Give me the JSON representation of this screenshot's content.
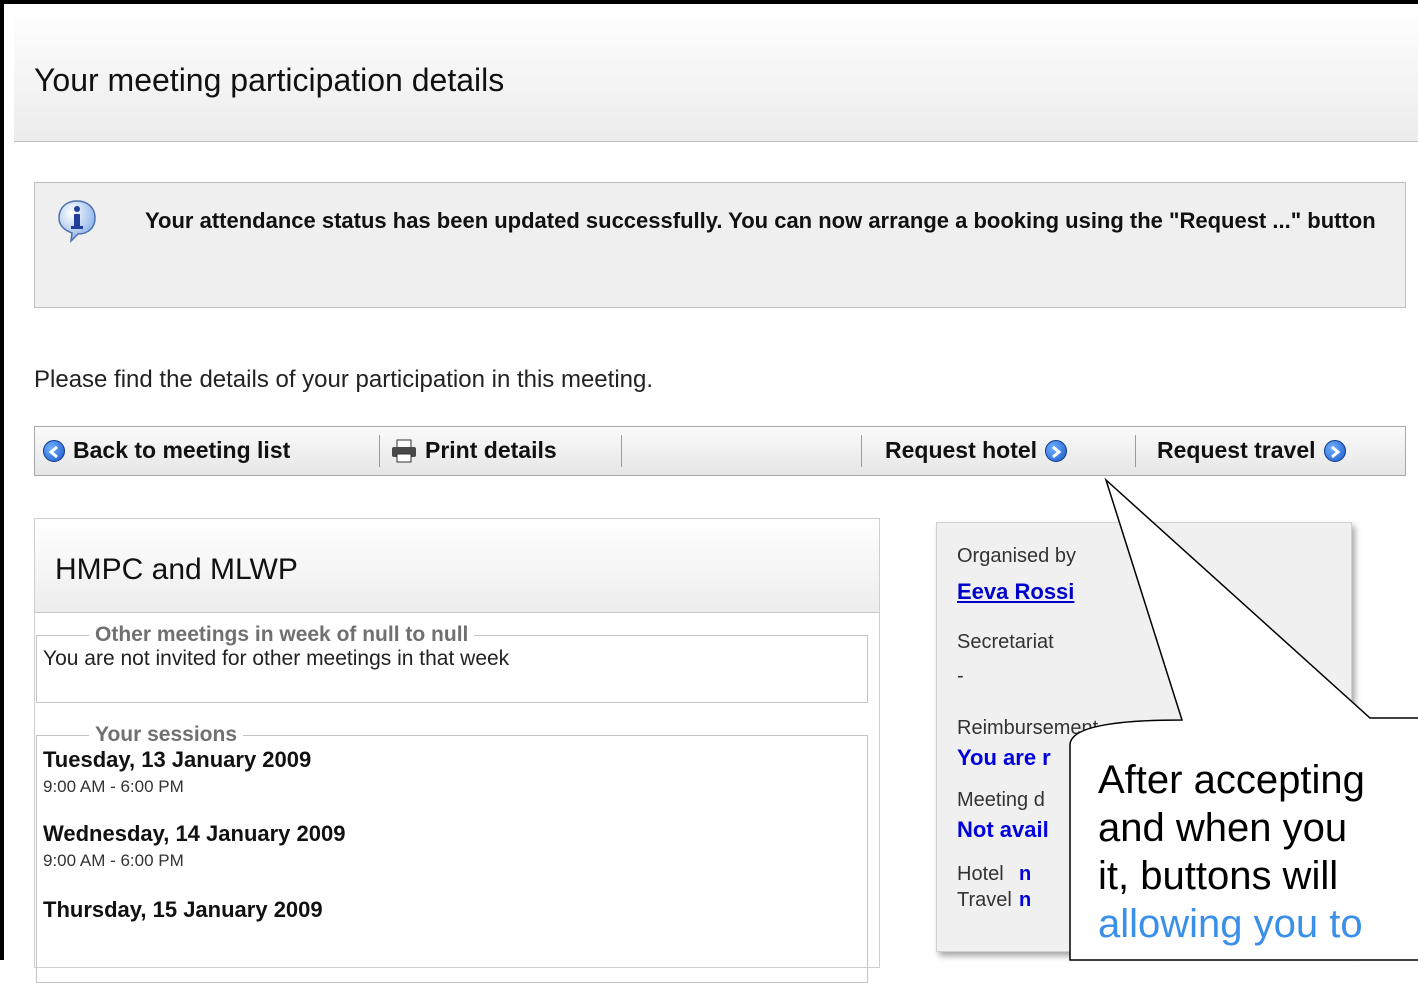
{
  "page": {
    "title": "Your meeting participation details"
  },
  "notice": {
    "icon": "info-icon",
    "message": "Your attendance status has been updated successfully. You can now arrange a booking using the \"Request ...\" button"
  },
  "intro": "Please find the details of your participation in this meeting.",
  "toolbar": {
    "back_label": "Back to meeting list",
    "print_label": "Print details",
    "hotel_label": "Request hotel",
    "travel_label": "Request travel"
  },
  "meeting": {
    "title": "HMPC and MLWP",
    "other_meetings": {
      "legend": "Other meetings in week of null to null",
      "text": "You are not invited for other meetings in that week"
    },
    "sessions": {
      "legend": "Your sessions",
      "items": [
        {
          "day": "Tuesday, 13 January 2009",
          "time": "9:00 AM - 6:00 PM"
        },
        {
          "day": "Wednesday, 14 January 2009",
          "time": "9:00 AM - 6:00 PM"
        },
        {
          "day": "Thursday, 15 January 2009"
        }
      ]
    }
  },
  "sidebar": {
    "organised_by_label": "Organised by",
    "organiser": "Eeva Rossi",
    "secretariat_label": "Secretariat",
    "secretariat_value": "-",
    "reimbursement_label": "Reimbursement",
    "reimbursement_value": "You are r",
    "meeting_docs_label": "Meeting d",
    "meeting_docs_value": "Not avail",
    "hotel_label": "Hotel",
    "hotel_value": "n",
    "travel_label": "Travel",
    "travel_value": "n"
  },
  "callout": {
    "line1": "After accepting",
    "line2": "and when you",
    "line3": "it, buttons will",
    "line4": "allowing you to"
  }
}
